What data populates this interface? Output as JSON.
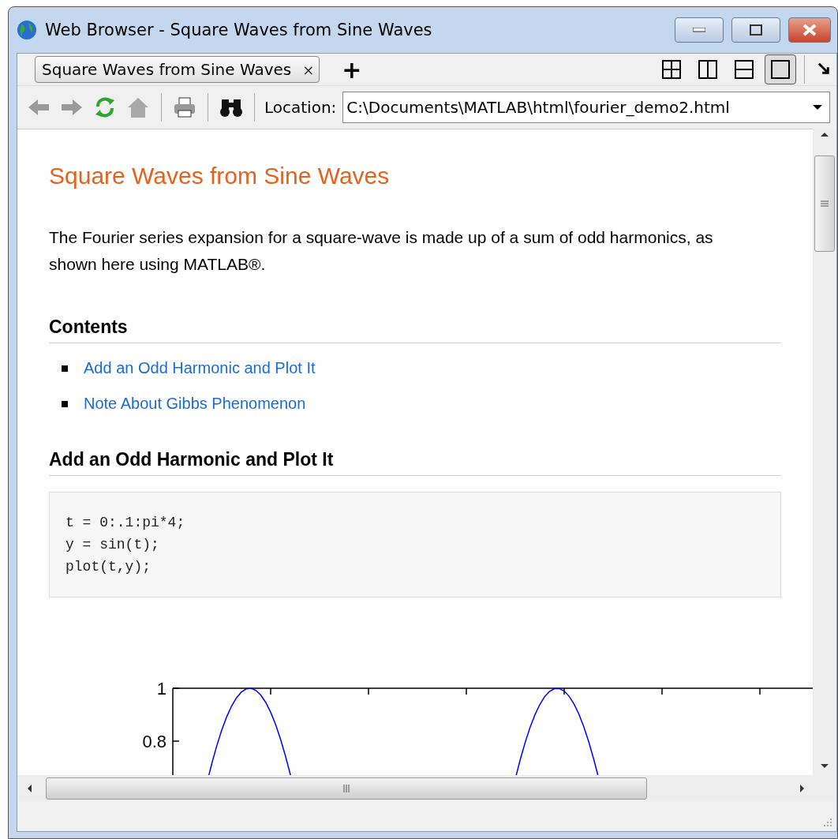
{
  "window": {
    "title": "Web Browser - Square Waves from Sine Waves"
  },
  "tabs": [
    {
      "label": "Square Waves from Sine Waves",
      "close": "×",
      "selected": true
    }
  ],
  "new_tab": "+",
  "layout_buttons": [
    {
      "kind": "grid",
      "selected": false
    },
    {
      "kind": "columns",
      "selected": false
    },
    {
      "kind": "rows",
      "selected": false
    },
    {
      "kind": "single",
      "selected": true
    }
  ],
  "toolbar": [
    {
      "kind": "back",
      "disabled": true
    },
    {
      "kind": "forward",
      "disabled": true
    },
    {
      "kind": "refresh",
      "disabled": false
    },
    {
      "kind": "home",
      "disabled": true
    },
    {
      "kind": "print",
      "disabled": false
    },
    {
      "kind": "find",
      "disabled": false
    }
  ],
  "location": {
    "label": "Location:",
    "value": "C:\\Documents\\MATLAB\\html\\fourier_demo2.html"
  },
  "page": {
    "title": "Square Waves from Sine Waves",
    "intro": "The Fourier series expansion for a square-wave is made up of a sum of odd harmonics, as shown here using MATLAB®.",
    "contents_heading": "Contents",
    "contents": [
      "Add an Odd Harmonic and Plot It",
      "Note About Gibbs Phenomenon"
    ],
    "section_heading": "Add an Odd Harmonic and Plot It",
    "code": [
      "t = 0:.1:pi*4;",
      "y = sin(t);",
      "plot(t,y);"
    ],
    "plot": {
      "y_tick_labels": [
        "1",
        "0.8"
      ]
    }
  }
}
